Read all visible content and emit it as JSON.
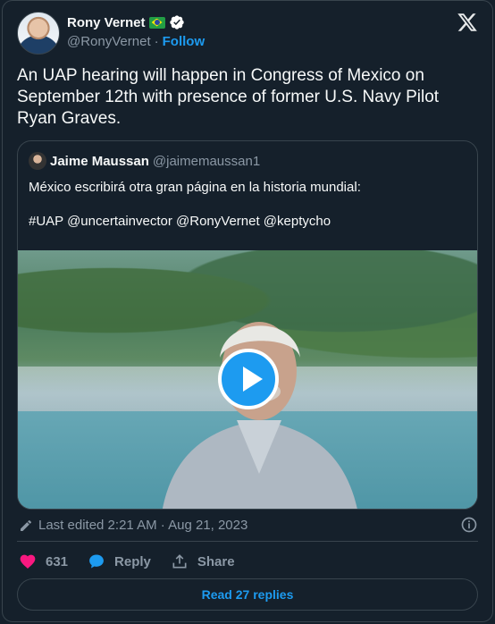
{
  "author": {
    "name": "Rony Vernet",
    "handle": "@RonyVernet",
    "separator": "·",
    "follow_label": "Follow",
    "flag_icon": "brazil-flag-icon",
    "verified_icon": "verified-badge-icon"
  },
  "tweet": {
    "text": "An UAP hearing will happen in Congress of Mexico on September 12th with presence of former U.S. Navy Pilot Ryan Graves."
  },
  "quote": {
    "name": "Jaime Maussan",
    "handle": "@jaimemaussan1",
    "line1": "México escribirá otra gran página en la historia mundial:",
    "line2": "#UAP @uncertainvector @RonyVernet @keptycho"
  },
  "meta": {
    "edited": "Last edited 2:21 AM · Aug 21, 2023"
  },
  "actions": {
    "like_count": "631",
    "reply_label": "Reply",
    "share_label": "Share"
  },
  "footer": {
    "read_replies": "Read 27 replies"
  },
  "colors": {
    "background": "#15202b",
    "border": "#38444d",
    "accent": "#1d9bf0",
    "like": "#f91880",
    "muted": "#8b98a5"
  }
}
